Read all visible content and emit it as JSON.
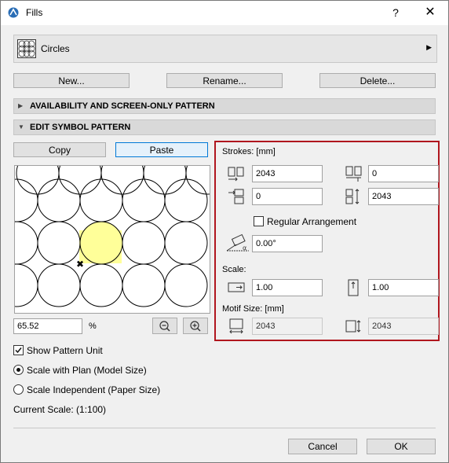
{
  "window": {
    "title": "Fills",
    "help": "?",
    "close": "✕"
  },
  "fill_selector": {
    "name": "Circles",
    "icon": "grid-pattern-icon"
  },
  "buttons": {
    "new": "New...",
    "rename": "Rename...",
    "delete": "Delete...",
    "copy": "Copy",
    "paste": "Paste",
    "cancel": "Cancel",
    "ok": "OK"
  },
  "sections": {
    "availability": "AVAILABILITY AND SCREEN-ONLY PATTERN",
    "edit_symbol": "EDIT SYMBOL PATTERN"
  },
  "preview": {
    "zoom_value": "65.52",
    "zoom_unit": "%",
    "highlight_color": "#ffff99"
  },
  "options": {
    "show_pattern_unit": "Show Pattern Unit",
    "scale_with_plan": "Scale with Plan (Model Size)",
    "scale_independent": "Scale Independent (Paper Size)",
    "current_scale": "Current Scale: (1:100)"
  },
  "strokes": {
    "header": "Strokes: [mm]",
    "x_spacing": "2043",
    "y_offset": "0",
    "x_offset": "0",
    "y_spacing": "2043",
    "regular_arrangement": "Regular Arrangement",
    "angle": "0.00°"
  },
  "scale": {
    "header": "Scale:",
    "x": "1.00",
    "y": "1.00"
  },
  "motif": {
    "header": "Motif Size: [mm]",
    "width": "2043",
    "height": "2043"
  },
  "colors": {
    "panel_border": "#b0161e",
    "focus_border": "#0078d7"
  }
}
